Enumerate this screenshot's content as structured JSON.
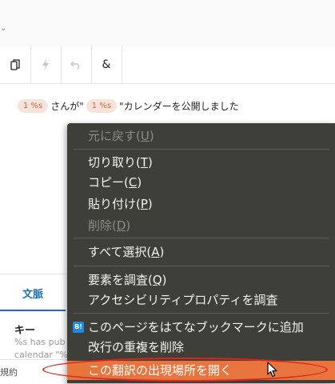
{
  "toolbar": {
    "buttons": [
      {
        "icon": "copy-icon"
      },
      {
        "icon": "lightning-icon"
      },
      {
        "icon": "undo-icon"
      },
      {
        "icon": "ampersand-icon"
      }
    ]
  },
  "source": {
    "placeholder1": "1 %s",
    "text1": "さんが\"",
    "placeholder2": "1 %s",
    "text2": "\"カレンダーを公開しました"
  },
  "tabs": {
    "context": "文脈"
  },
  "key_section": {
    "label": "キー",
    "desc_line1": "%s has pub",
    "desc_line2": "calendar \"%"
  },
  "bottom": {
    "label": "規約"
  },
  "context_menu": {
    "undo": {
      "pre": "元に戻す(",
      "key": "U",
      "post": ")"
    },
    "cut": {
      "pre": "切り取り(",
      "key": "T",
      "post": ")"
    },
    "copy": {
      "pre": "コピー(",
      "key": "C",
      "post": ")"
    },
    "paste": {
      "pre": "貼り付け(",
      "key": "P",
      "post": ")"
    },
    "delete": {
      "pre": "削除(",
      "key": "D",
      "post": ")"
    },
    "select_all": {
      "pre": "すべて選択(",
      "key": "A",
      "post": ")"
    },
    "inspect": {
      "pre": "要素を調査(",
      "key": "Q",
      "post": ")"
    },
    "inspect_a11y": "アクセシビリティプロパティを調査",
    "hatena_badge": "B!",
    "hatena": "このページをはてなブックマークに追加",
    "remove_newlines": "改行の重複を削除",
    "open_location": "この翻訳の出現場所を開く"
  },
  "colors": {
    "menu_bg": "#3f3f3a",
    "highlight": "#e8753e",
    "accent": "#1b6fb5",
    "annotation": "#e0241b"
  }
}
